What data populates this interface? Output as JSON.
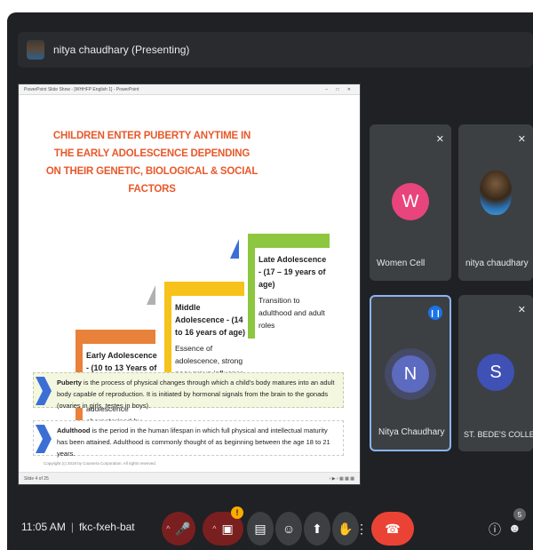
{
  "presenter": {
    "name": "nitya chaudhary (Presenting)"
  },
  "ppt": {
    "window_title": "PowerPoint Slide Show - [WHHFP English 1] - PowerPoint",
    "window_buttons": "– □ ✕",
    "title": "CHILDREN ENTER PUBERTY ANYTIME IN THE EARLY ADOLESCENCE DEPENDING ON THEIR GENETIC, BIOLOGICAL & SOCIAL FACTORS",
    "stages": [
      {
        "heading": "Early Adolescence - (10 to 13 Years of age)",
        "desc": "Transition to adolescence characterised by puberty",
        "color": "#e8813a"
      },
      {
        "heading": "Middle Adolescence - (14 to 16 years of age)",
        "desc": "Essence of adolescence, strong peer group influence",
        "color": "#f7c31b"
      },
      {
        "heading": "Late Adolescence - (17 – 19 years of age)",
        "desc": "Transition to adulthood and adult roles",
        "color": "#8dc63f"
      }
    ],
    "fact1": {
      "term": "Puberty",
      "text": " is the process of physical changes through which a child's body matures into an adult body capable of reproduction. It is initiated by hormonal signals from the brain to the gonads (ovaries in girls, testes in boys)."
    },
    "fact2": {
      "term": "Adulthood",
      "text": " is the period in the human lifespan in which full physical and intellectual maturity has been attained. Adulthood is commonly thought of as beginning between the age 18 to 21 years."
    },
    "copyright": "Copyright (c) 2019 by Coursera Corporation. All rights reserved.",
    "slide_counter": "Slide 4 of 25",
    "status_icons": "‹ ▶ ›   ▦ ▦ ▦"
  },
  "tiles": [
    {
      "name": "Women Cell",
      "initial": "W",
      "color": "#e8457c",
      "muted": true
    },
    {
      "name": "nitya chaudhary",
      "initial": "",
      "color": "",
      "muted": true
    },
    {
      "name": "Nitya Chaudhary",
      "initial": "N",
      "color": "#5c6bc0",
      "speaking": true
    },
    {
      "name": "ST. BEDE'S COLLEGE",
      "initial": "S",
      "color": "#3f51b5",
      "muted": true
    }
  ],
  "bottom": {
    "time": "11:05 AM",
    "meeting_code": "fkc-fxeh-bat",
    "warning": "!",
    "participant_count": "5"
  },
  "icons": {
    "mic": "mic-off-icon",
    "cam": "camera-off-icon",
    "cc": "captions-icon",
    "emoji": "emoji-icon",
    "present": "present-icon",
    "hand": "raise-hand-icon",
    "more": "more-icon",
    "end": "end-call-icon",
    "info": "info-icon",
    "people": "people-icon"
  }
}
